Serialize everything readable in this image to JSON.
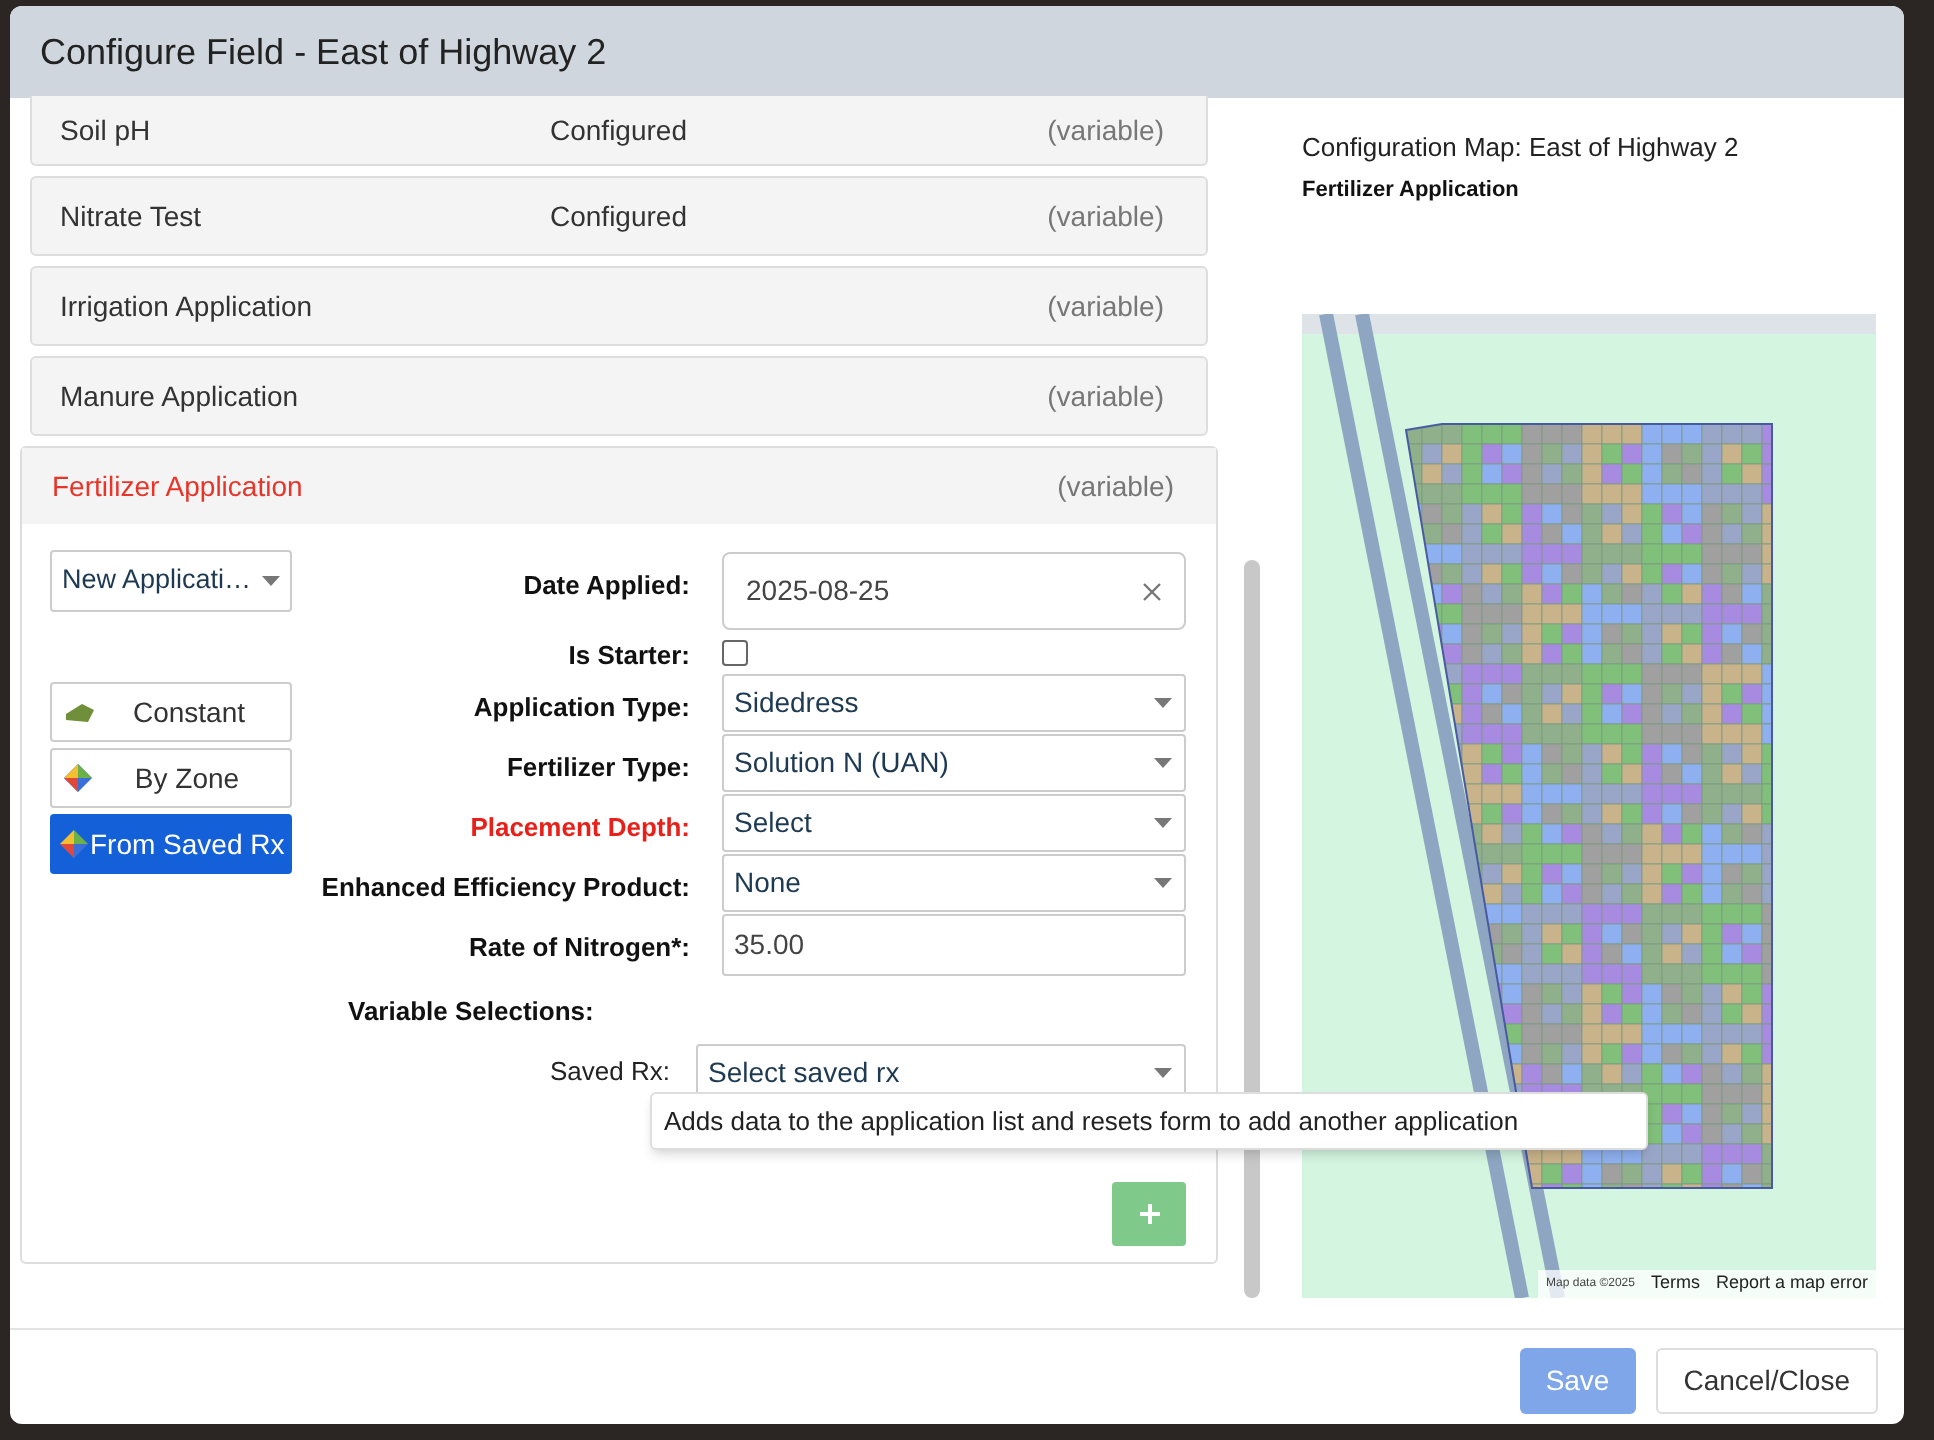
{
  "window": {
    "title": "Configure Field - East of Highway 2"
  },
  "sections": [
    {
      "name": "Soil pH",
      "status": "Configured",
      "mode": "(variable)",
      "expanded": false
    },
    {
      "name": "Nitrate Test",
      "status": "Configured",
      "mode": "(variable)",
      "expanded": false
    },
    {
      "name": "Irrigation Application",
      "mode": "(variable)",
      "expanded": false
    },
    {
      "name": "Manure Application",
      "mode": "(variable)",
      "expanded": false
    },
    {
      "name": "Fertilizer Application",
      "mode": "(variable)",
      "expanded": true
    }
  ],
  "form": {
    "application_select": "New Applicati…",
    "methods": [
      {
        "kind": "constant",
        "label": "Constant",
        "selected": false
      },
      {
        "kind": "zone",
        "label": "By Zone",
        "selected": false
      },
      {
        "kind": "zone",
        "label": "From Saved Rx",
        "selected": true
      }
    ],
    "fields": [
      {
        "kind": "date",
        "label": "Date Applied:",
        "value": "2025-08-25",
        "error": false
      },
      {
        "kind": "checkbox",
        "label": "Is Starter:",
        "checked": false,
        "error": false
      },
      {
        "kind": "select",
        "label": "Application Type:",
        "value": "Sidedress",
        "error": false
      },
      {
        "kind": "select",
        "label": "Fertilizer Type:",
        "value": "Solution N (UAN)",
        "error": false
      },
      {
        "kind": "select",
        "label": "Placement Depth:",
        "value": "Select",
        "error": true
      },
      {
        "kind": "select",
        "label": "Enhanced Efficiency Product:",
        "value": "None",
        "error": false
      },
      {
        "kind": "text",
        "label": "Rate of Nitrogen*:",
        "value": "35.00",
        "error": false
      }
    ],
    "variable_selections": "Variable Selections:",
    "saved_rx": {
      "label": "Saved Rx:",
      "value": "Select saved rx"
    },
    "tooltip": "Adds data to the application list and resets form to add another application"
  },
  "map": {
    "title": "Configuration Map: East of Highway 2",
    "subtitle": "Fertilizer Application",
    "attribution": [
      {
        "kind": "note",
        "text": "Map data ©2025"
      },
      {
        "kind": "link",
        "text": "Terms"
      },
      {
        "kind": "link",
        "text": "Report a map error"
      }
    ]
  },
  "footer": {
    "buttons": [
      {
        "label": "Save",
        "kind": "primary",
        "disabled": true
      },
      {
        "label": "Cancel/Close",
        "kind": "secondary",
        "disabled": false
      }
    ]
  }
}
